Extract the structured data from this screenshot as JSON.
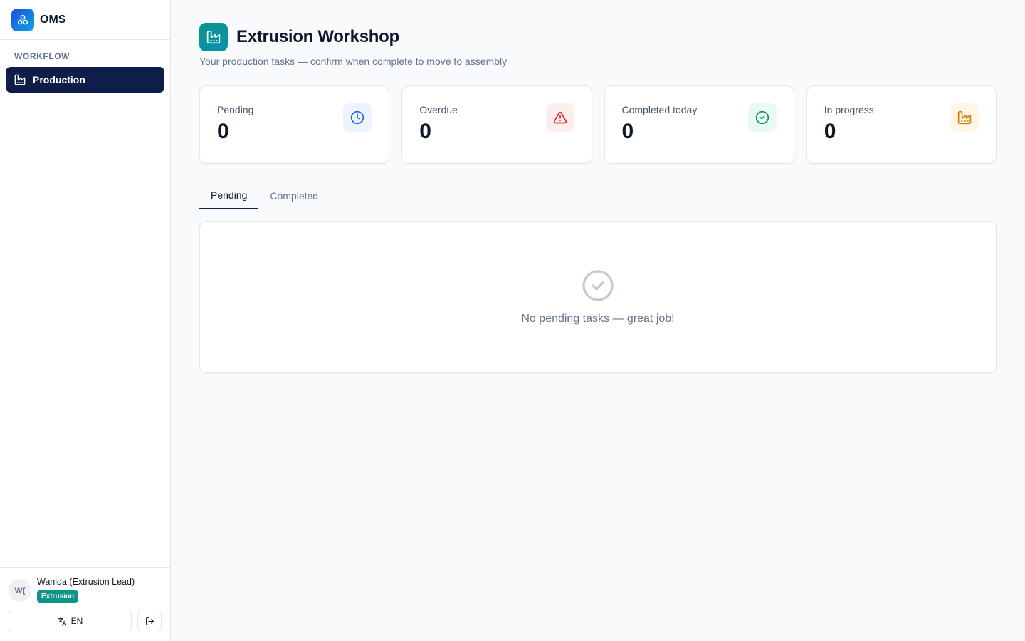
{
  "brand": {
    "name": "OMS"
  },
  "sidebar": {
    "section_label": "WORKFLOW",
    "items": [
      {
        "label": "Production",
        "icon": "factory-icon",
        "active": true
      }
    ]
  },
  "user": {
    "initials": "W(",
    "name": "Wanida (Extrusion Lead)",
    "badge": "Extrusion",
    "language": "EN"
  },
  "page": {
    "title": "Extrusion Workshop",
    "subtitle": "Your production tasks — confirm when complete to move to assembly"
  },
  "stats": [
    {
      "label": "Pending",
      "value": "0",
      "icon": "clock-icon",
      "color": "#2563eb",
      "bg": "#eef4ff"
    },
    {
      "label": "Overdue",
      "value": "0",
      "icon": "warning-icon",
      "color": "#dc2626",
      "bg": "#fdeeee"
    },
    {
      "label": "Completed today",
      "value": "0",
      "icon": "check-circle-icon",
      "color": "#059669",
      "bg": "#eafaf3"
    },
    {
      "label": "In progress",
      "value": "0",
      "icon": "factory-icon",
      "color": "#d97706",
      "bg": "#fef6e6"
    }
  ],
  "tabs": [
    {
      "label": "Pending",
      "active": true
    },
    {
      "label": "Completed",
      "active": false
    }
  ],
  "empty_state": {
    "message": "No pending tasks — great job!",
    "icon": "check-circle-icon"
  },
  "colors": {
    "primary": "#0f1d4a",
    "accent": "#0d9488"
  }
}
